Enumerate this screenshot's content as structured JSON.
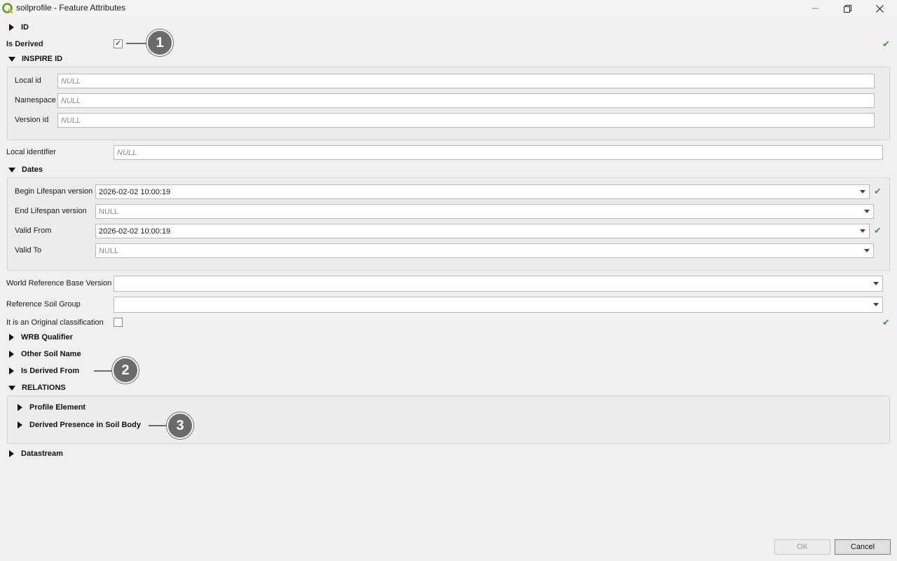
{
  "window": {
    "title": "soilprofile - Feature Attributes"
  },
  "groups": {
    "id": "ID",
    "inspire_id": "INSPIRE ID",
    "dates": "Dates",
    "wrb_qualifier": "WRB Qualifier",
    "other_soil_name": "Other Soil Name",
    "is_derived_from": "Is Derived From",
    "relations": "RELATIONS",
    "profile_element": "Profile Element",
    "derived_presence": "Derived Presence in Soil Body",
    "datastream": "Datastream"
  },
  "fields": {
    "is_derived": {
      "label": "Is Derived",
      "checked": true,
      "check_mark": "✓"
    },
    "local_id": {
      "label": "Local id",
      "value": "NULL"
    },
    "namespace": {
      "label": "Namespace",
      "value": "NULL"
    },
    "version_id": {
      "label": "Version id",
      "value": "NULL"
    },
    "local_identifier": {
      "label": "Local identifier",
      "value": "NULL"
    },
    "begin_lifespan": {
      "label": "Begin Lifespan version",
      "value": "2026-02-02 10:00:19"
    },
    "end_lifespan": {
      "label": "End Lifespan version",
      "value": "NULL"
    },
    "valid_from": {
      "label": "Valid From",
      "value": "2026-02-02 10:00:19"
    },
    "valid_to": {
      "label": "Valid To",
      "value": "NULL"
    },
    "wrb_version": {
      "label": "World Reference Base Version",
      "value": ""
    },
    "ref_soil_group": {
      "label": "Reference Soil Group",
      "value": ""
    },
    "original_class": {
      "label": "It is an Original classification",
      "checked": false
    }
  },
  "status": {
    "ok_mark": "✔",
    "ok_color": "#3aa335"
  },
  "callouts": [
    "1",
    "2",
    "3"
  ],
  "buttons": {
    "ok": "OK",
    "cancel": "Cancel"
  },
  "icons": {
    "app": "qgis-logo-icon",
    "minimize": "minimize-icon",
    "maximize": "restore-icon",
    "close": "close-icon"
  }
}
